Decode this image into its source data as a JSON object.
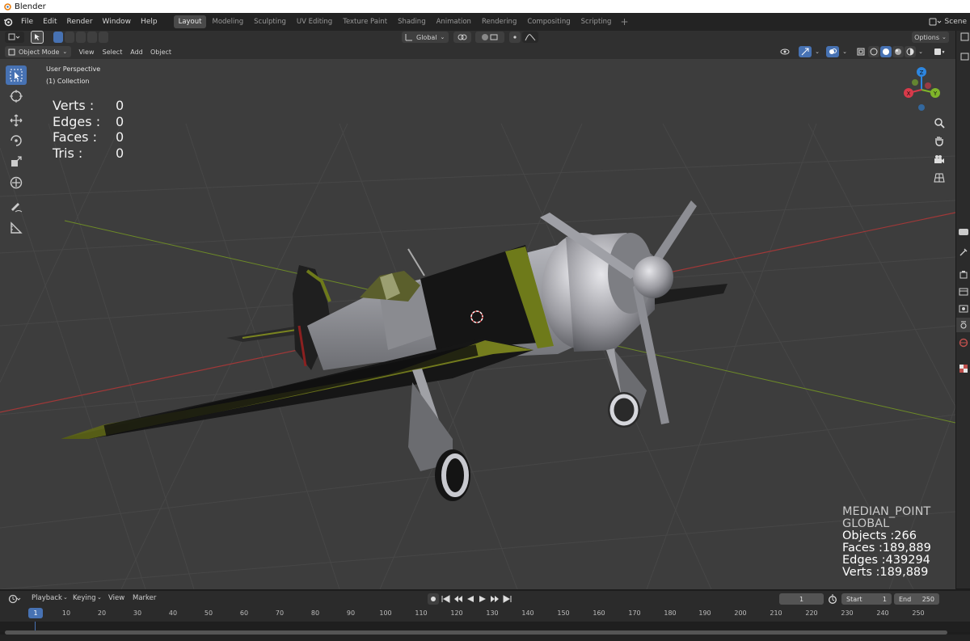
{
  "window": {
    "title": "Blender"
  },
  "topbar": {
    "menus": [
      "File",
      "Edit",
      "Render",
      "Window",
      "Help"
    ],
    "workspaces": [
      "Layout",
      "Modeling",
      "Sculpting",
      "UV Editing",
      "Texture Paint",
      "Shading",
      "Animation",
      "Rendering",
      "Compositing",
      "Scripting"
    ],
    "active_workspace": "Layout",
    "scene_label": "Scene"
  },
  "header": {
    "transform_orientation": "Global",
    "options_label": "Options",
    "mode": "Object Mode",
    "menus": [
      "View",
      "Select",
      "Add",
      "Object"
    ]
  },
  "viewport": {
    "perspective_label": "User Perspective",
    "collection_label": "(1) Collection",
    "stats": [
      {
        "label": "Verts :",
        "value": "0"
      },
      {
        "label": "Edges :",
        "value": "0"
      },
      {
        "label": "Faces :",
        "value": "0"
      },
      {
        "label": "Tris :",
        "value": "0"
      }
    ],
    "overlay": {
      "pivot": "MEDIAN_POINT",
      "orientation": "GLOBAL",
      "objects": "Objects :266",
      "faces": "Faces :189,889",
      "edges": "Edges :439294",
      "verts": "Verts :189,889"
    },
    "gizmo_axes": {
      "x": "X",
      "y": "Y",
      "z": "Z"
    }
  },
  "timeline": {
    "menus": [
      "Playback",
      "Keying",
      "View",
      "Marker"
    ],
    "current_frame": "1",
    "start_label": "Start",
    "start_value": "1",
    "end_label": "End",
    "end_value": "250",
    "ticks": [
      "10",
      "20",
      "30",
      "40",
      "50",
      "60",
      "70",
      "80",
      "90",
      "100",
      "110",
      "120",
      "130",
      "140",
      "150",
      "160",
      "170",
      "180",
      "190",
      "200",
      "210",
      "220",
      "230",
      "240",
      "250"
    ]
  },
  "colors": {
    "accent": "#4772b3",
    "viewport_bg": "#3d3d3d",
    "x_axis": "#a03838",
    "y_axis": "#7a9a2a",
    "olive": "#6e7a1a"
  }
}
